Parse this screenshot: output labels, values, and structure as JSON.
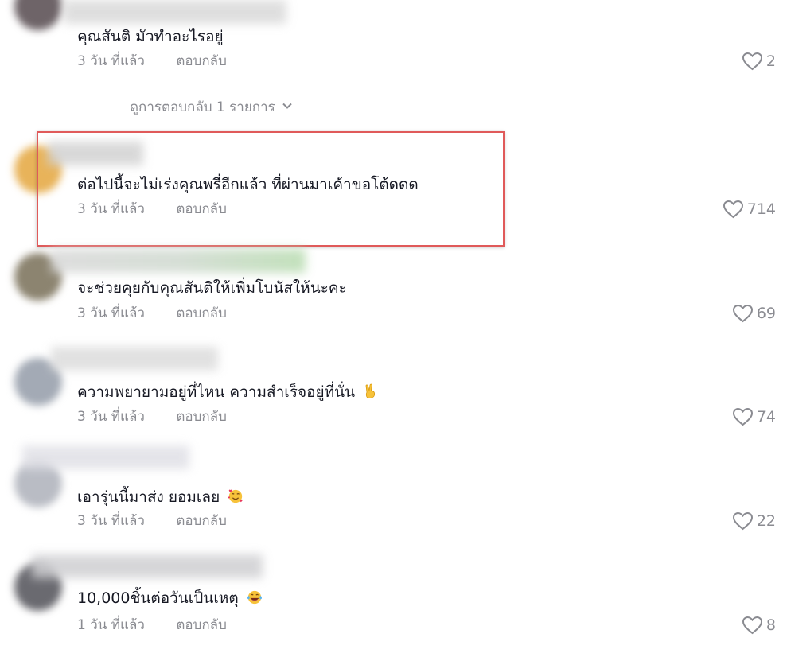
{
  "comments": [
    {
      "text": "คุณสันติ มัวทำอะไรอยู่",
      "time": "3 วัน ที่แล้ว",
      "reply": "ตอบกลับ",
      "likes": "2"
    },
    {
      "text": "ต่อไปนี้จะไม่เร่งคุณพรี่อีกแล้ว ที่ผ่านมาเค้าขอโต้ดดด",
      "time": "3 วัน ที่แล้ว",
      "reply": "ตอบกลับ",
      "likes": "714"
    },
    {
      "text": "จะช่วยคุยกับคุณสันติให้เพิ่มโบนัสให้นะคะ",
      "time": "3 วัน ที่แล้ว",
      "reply": "ตอบกลับ",
      "likes": "69"
    },
    {
      "text": "ความพยายามอยู่ที่ไหน ความสำเร็จอยู่ที่นั่น",
      "emoji": "victory-hand-emoji",
      "time": "3 วัน ที่แล้ว",
      "reply": "ตอบกลับ",
      "likes": "74"
    },
    {
      "text": "เอารุ่นนี้มาส่ง ยอมเลย",
      "emoji": "smiling-face-with-hearts-emoji",
      "time": "3 วัน ที่แล้ว",
      "reply": "ตอบกลับ",
      "likes": "22"
    },
    {
      "text": "10,000ชิ้นต่อวันเป็นเหตุ",
      "emoji": "face-with-tears-of-joy-emoji",
      "time": "1 วัน ที่แล้ว",
      "reply": "ตอบกลับ",
      "likes": "8"
    }
  ],
  "view_replies": {
    "label": "ดูการตอบกลับ 1 รายการ"
  },
  "colors": {
    "text": "#161823",
    "muted": "#8a8b91",
    "highlight_border": "#e05a5a"
  }
}
